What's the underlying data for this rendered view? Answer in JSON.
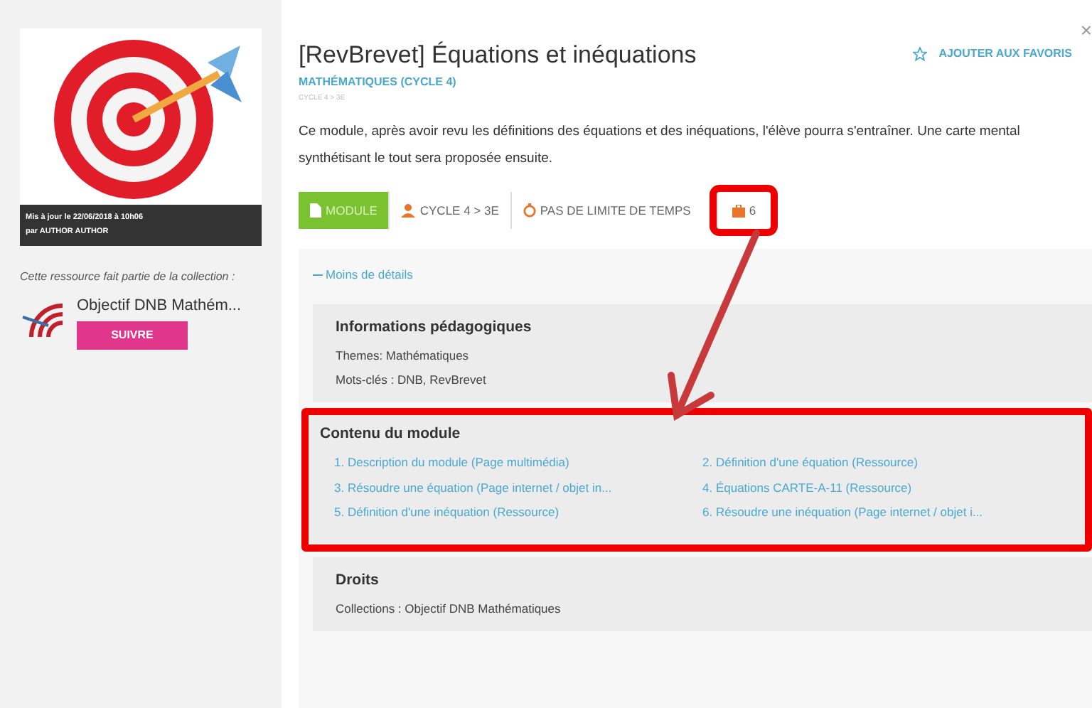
{
  "sidebar": {
    "update_caption": [
      "Mis à jour le 22/06/2018 à 10h06",
      "par AUTHOR AUTHOR"
    ],
    "collection_intro": "Cette ressource fait partie de la collection :",
    "collection": {
      "name": "Objectif DNB Mathém...",
      "follow_button": "SUIVRE"
    }
  },
  "header": {
    "title": "[RevBrevet] Équations et inéquations",
    "subject": "MATHÉMATIQUES (CYCLE 4)",
    "level": "CYCLE 4 > 3E",
    "favorite": "AJOUTER AUX FAVORIS",
    "close": "×"
  },
  "description": "Ce module, après avoir revu les définitions des équations et des inéquations, l'élève pourra s'entraîner. Une carte mental synthétisant le tout sera proposée ensuite.",
  "badges": [
    {
      "kind": "type",
      "label": "MODULE"
    },
    {
      "kind": "level",
      "label": "CYCLE 4 > 3E"
    },
    {
      "kind": "time",
      "label": "PAS DE LIMITE DE TEMPS"
    },
    {
      "kind": "count",
      "label": "6",
      "highlighted": true
    }
  ],
  "details": {
    "toggle": "Moins de détails",
    "sections": [
      {
        "title": "Informations pédagogiques",
        "highlighted": false,
        "lines": [
          "Themes: Mathématiques",
          "Mots-clés : DNB, RevBrevet"
        ]
      },
      {
        "title": "Contenu du module",
        "highlighted": true,
        "links": [
          "1. Description du module (Page multimédia)",
          "2. Définition d'une équation (Ressource)",
          "3. Résoudre une équation (Page internet / objet in...",
          "4. Équations CARTE-A-11 (Ressource)",
          "5. Définition d'une inéquation (Ressource)",
          "6. Résoudre une inéquation (Page internet / objet i..."
        ]
      },
      {
        "title": "Droits",
        "highlighted": false,
        "lines": [
          "Collections : Objectif DNB Mathématiques"
        ]
      }
    ]
  }
}
